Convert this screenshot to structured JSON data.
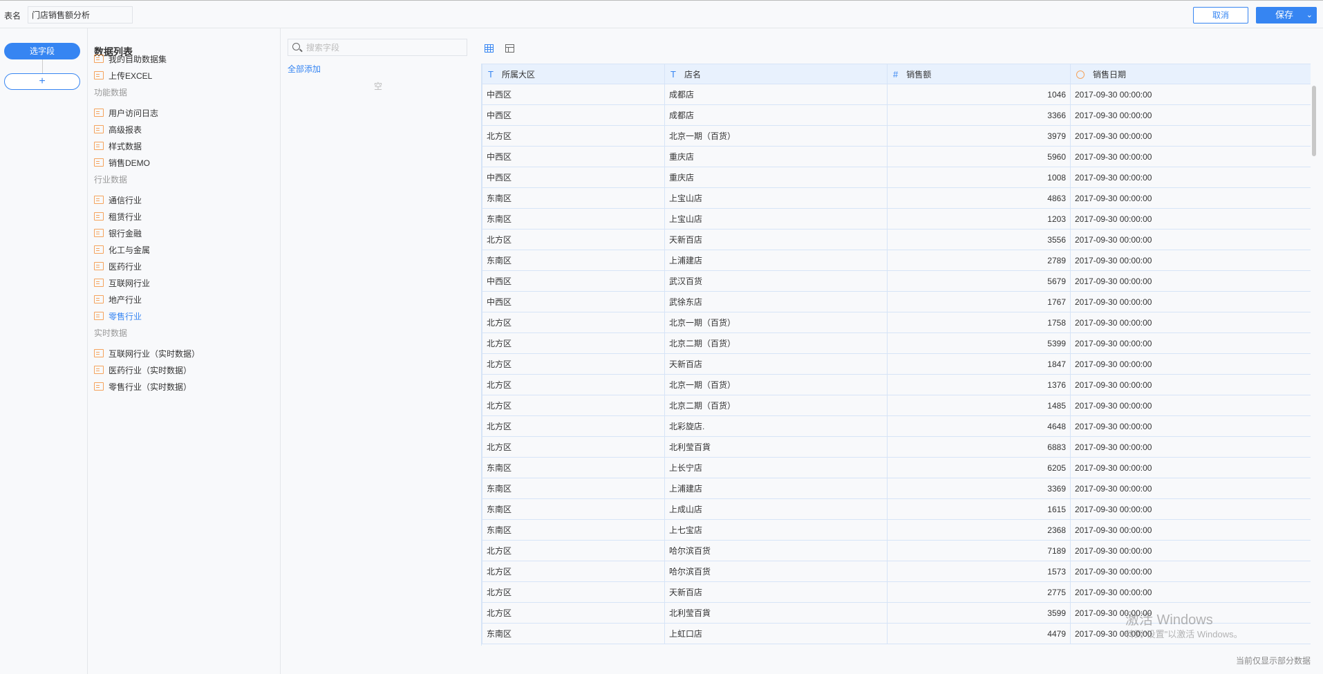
{
  "header": {
    "table_name_label": "表名",
    "table_name_value": "门店销售额分析",
    "cancel_label": "取消",
    "save_label": "保存"
  },
  "steps": {
    "active_label": "选字段",
    "add_label": "+"
  },
  "data_list": {
    "title": "数据列表",
    "top_items": [
      {
        "label": "我的自助数据集",
        "icon": "user-folder-icon"
      },
      {
        "label": "上传EXCEL",
        "icon": "folder-icon"
      }
    ],
    "groups": [
      {
        "title": "功能数据",
        "items": [
          "用户访问日志",
          "高级报表",
          "样式数据",
          "销售DEMO"
        ]
      },
      {
        "title": "行业数据",
        "items": [
          "通信行业",
          "租赁行业",
          "银行金融",
          "化工与金属",
          "医药行业",
          "互联网行业",
          "地产行业",
          "零售行业"
        ]
      },
      {
        "title": "实时数据",
        "items": [
          "互联网行业（实时数据）",
          "医药行业（实时数据）",
          "零售行业（实时数据）"
        ]
      }
    ],
    "selected": "零售行业"
  },
  "fields": {
    "search_placeholder": "搜索字段",
    "add_all_label": "全部添加",
    "empty_label": "空"
  },
  "table": {
    "columns": [
      {
        "label": "所属大区",
        "type_icon": "T"
      },
      {
        "label": "店名",
        "type_icon": "T"
      },
      {
        "label": "销售额",
        "type_icon": "#"
      },
      {
        "label": "销售日期",
        "type_icon": "clock"
      }
    ],
    "rows": [
      [
        "中西区",
        "成都店",
        "1046",
        "2017-09-30 00:00:00"
      ],
      [
        "中西区",
        "成都店",
        "3366",
        "2017-09-30 00:00:00"
      ],
      [
        "北方区",
        "北京一期（百货）",
        "3979",
        "2017-09-30 00:00:00"
      ],
      [
        "中西区",
        "重庆店",
        "5960",
        "2017-09-30 00:00:00"
      ],
      [
        "中西区",
        "重庆店",
        "1008",
        "2017-09-30 00:00:00"
      ],
      [
        "东南区",
        "上宝山店",
        "4863",
        "2017-09-30 00:00:00"
      ],
      [
        "东南区",
        "上宝山店",
        "1203",
        "2017-09-30 00:00:00"
      ],
      [
        "北方区",
        "天新百店",
        "3556",
        "2017-09-30 00:00:00"
      ],
      [
        "东南区",
        "上浦建店",
        "2789",
        "2017-09-30 00:00:00"
      ],
      [
        "中西区",
        "武汉百货",
        "5679",
        "2017-09-30 00:00:00"
      ],
      [
        "中西区",
        "武徐东店",
        "1767",
        "2017-09-30 00:00:00"
      ],
      [
        "北方区",
        "北京一期（百货）",
        "1758",
        "2017-09-30 00:00:00"
      ],
      [
        "北方区",
        "北京二期（百货）",
        "5399",
        "2017-09-30 00:00:00"
      ],
      [
        "北方区",
        "天新百店",
        "1847",
        "2017-09-30 00:00:00"
      ],
      [
        "北方区",
        "北京一期（百货）",
        "1376",
        "2017-09-30 00:00:00"
      ],
      [
        "北方区",
        "北京二期（百货）",
        "1485",
        "2017-09-30 00:00:00"
      ],
      [
        "北方区",
        "北彩旋店.",
        "4648",
        "2017-09-30 00:00:00"
      ],
      [
        "北方区",
        "北利莹百貨",
        "6883",
        "2017-09-30 00:00:00"
      ],
      [
        "东南区",
        "上长宁店",
        "6205",
        "2017-09-30 00:00:00"
      ],
      [
        "东南区",
        "上浦建店",
        "3369",
        "2017-09-30 00:00:00"
      ],
      [
        "东南区",
        "上成山店",
        "1615",
        "2017-09-30 00:00:00"
      ],
      [
        "东南区",
        "上七宝店",
        "2368",
        "2017-09-30 00:00:00"
      ],
      [
        "北方区",
        "哈尔滨百货",
        "7189",
        "2017-09-30 00:00:00"
      ],
      [
        "北方区",
        "哈尔滨百货",
        "1573",
        "2017-09-30 00:00:00"
      ],
      [
        "北方区",
        "天新百店",
        "2775",
        "2017-09-30 00:00:00"
      ],
      [
        "北方区",
        "北利莹百貨",
        "3599",
        "2017-09-30 00:00:00"
      ],
      [
        "东南区",
        "上虹口店",
        "4479",
        "2017-09-30 00:00:00"
      ]
    ],
    "footer_note": "当前仅显示部分数据"
  },
  "watermark": {
    "line1": "激活 Windows",
    "line2": "转到\"设置\"以激活 Windows。"
  },
  "colors": {
    "accent": "#3685f2",
    "folder": "#f5a35c",
    "header_bg": "#e8f1fd"
  }
}
